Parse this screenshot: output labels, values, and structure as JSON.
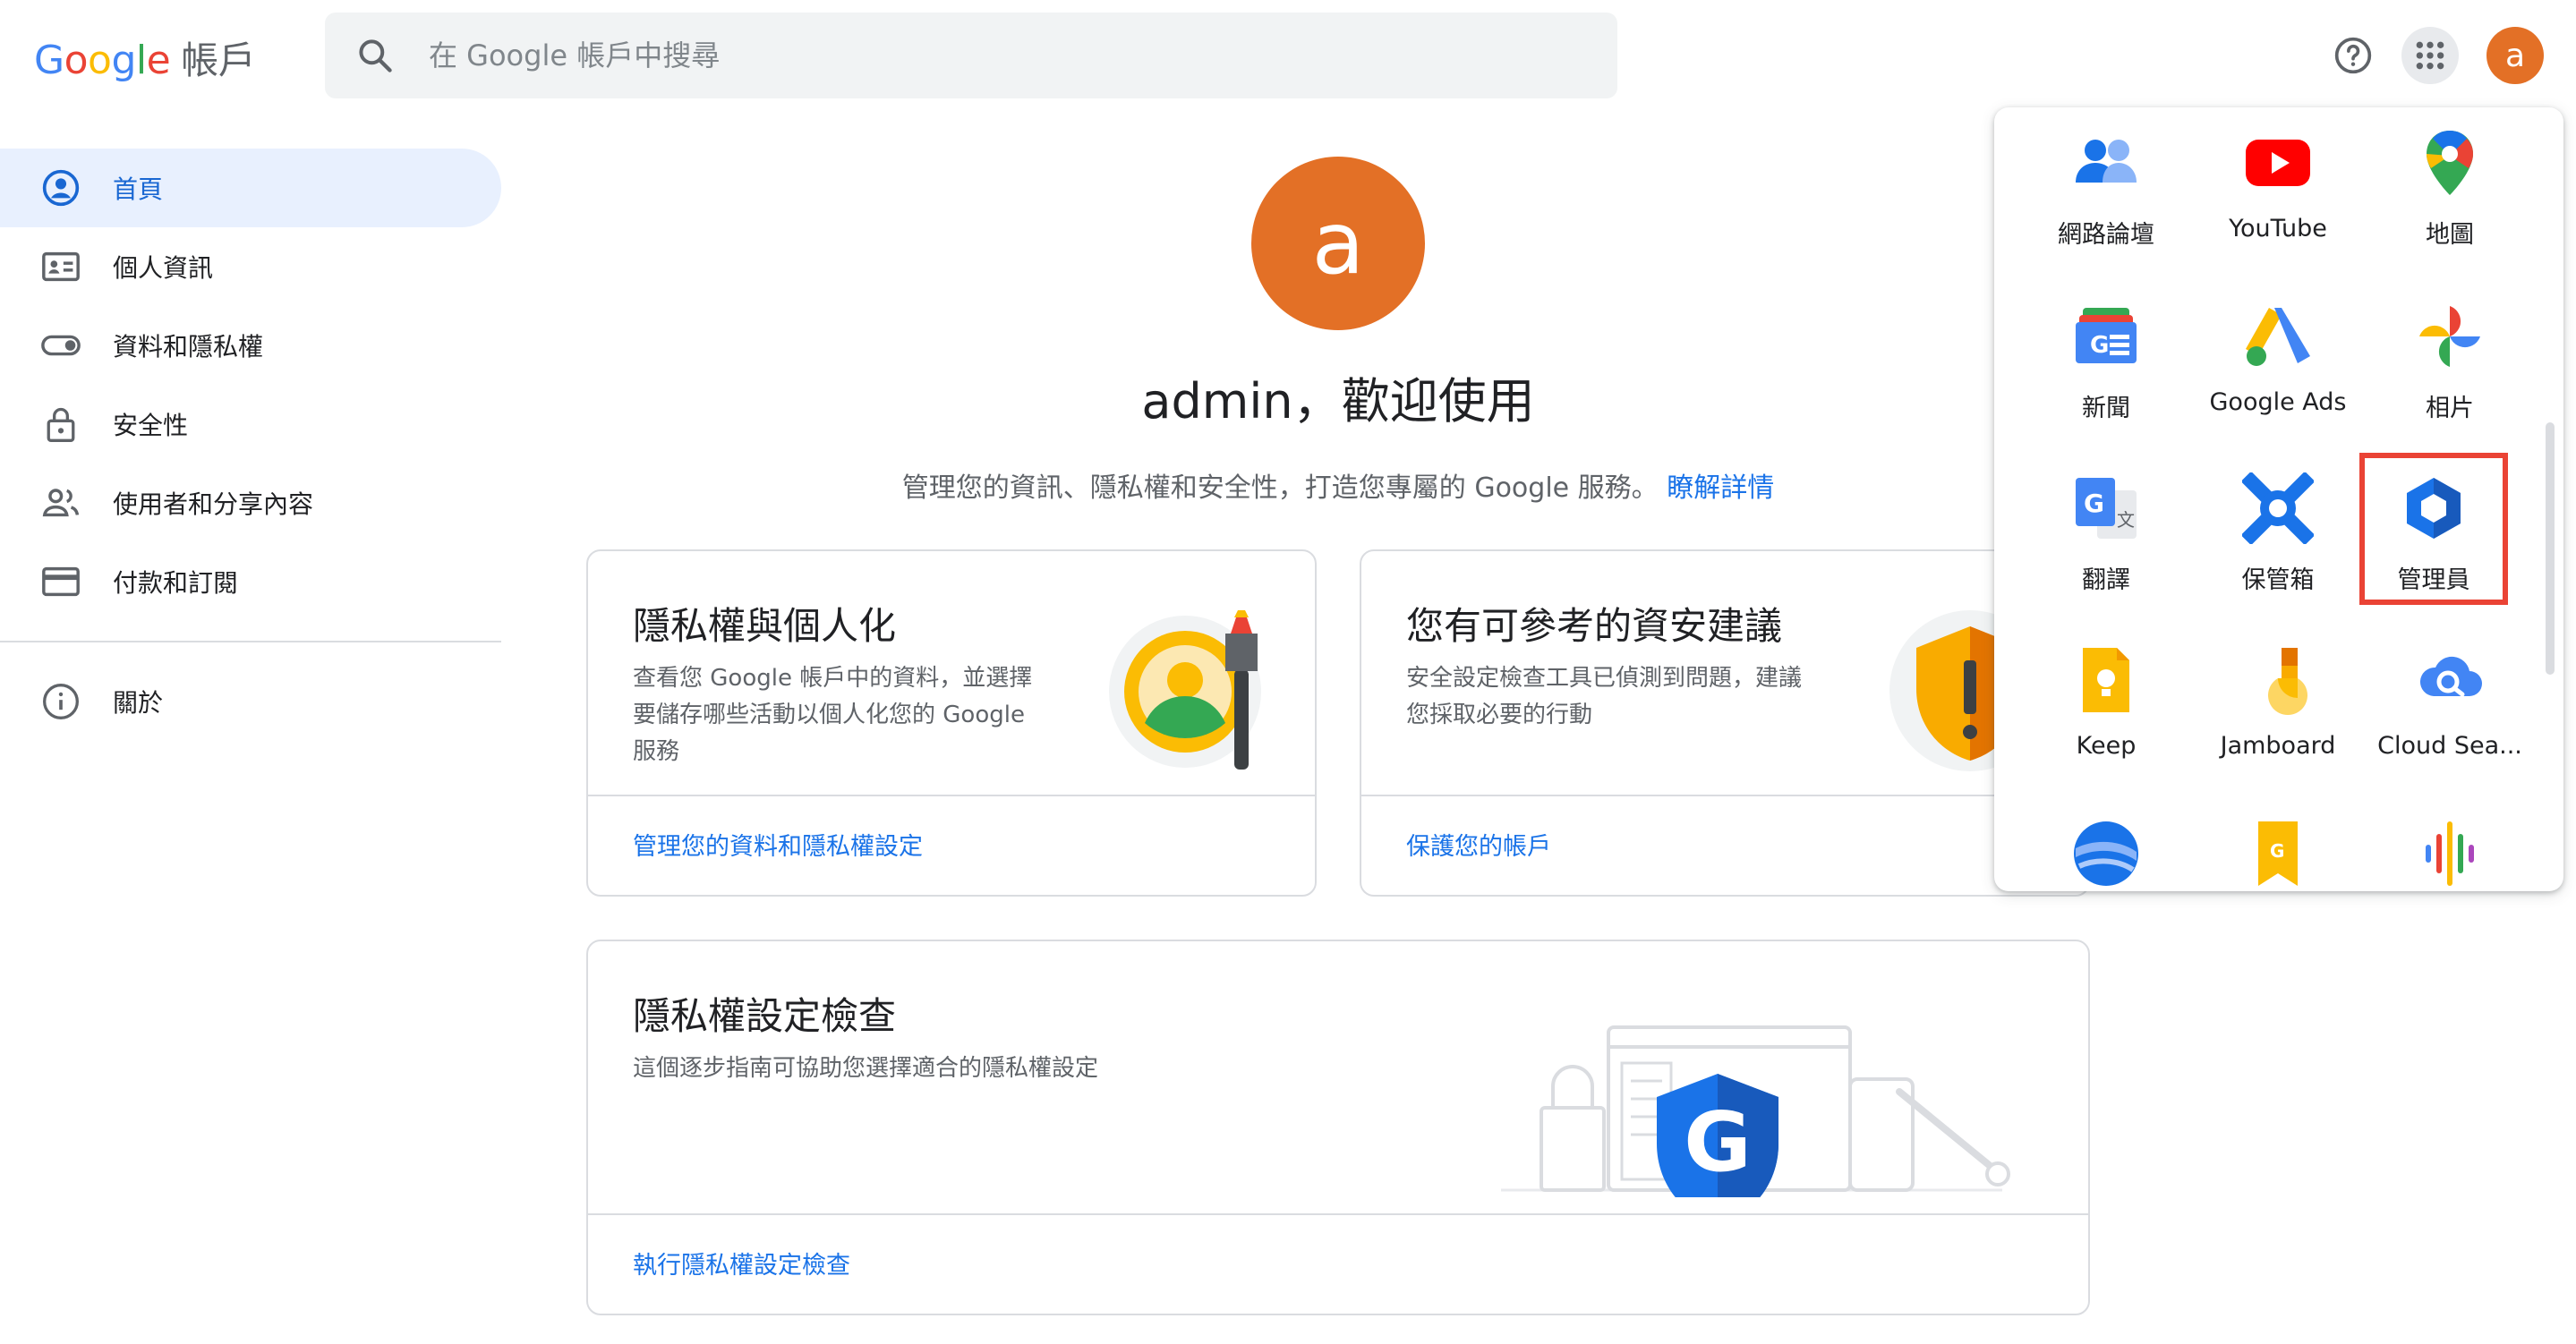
{
  "header": {
    "logo_letters": [
      "G",
      "o",
      "o",
      "g",
      "l",
      "e"
    ],
    "product_name": "帳戶",
    "search_placeholder": "在 Google 帳戶中搜尋",
    "avatar_letter": "a"
  },
  "sidebar": {
    "items": [
      {
        "label": "首頁",
        "icon": "account-circle-icon",
        "active": true
      },
      {
        "label": "個人資訊",
        "icon": "id-card-icon",
        "active": false
      },
      {
        "label": "資料和隱私權",
        "icon": "toggle-icon",
        "active": false
      },
      {
        "label": "安全性",
        "icon": "lock-icon",
        "active": false
      },
      {
        "label": "使用者和分享內容",
        "icon": "people-icon",
        "active": false
      },
      {
        "label": "付款和訂閱",
        "icon": "credit-card-icon",
        "active": false
      }
    ],
    "about_label": "關於"
  },
  "main": {
    "avatar_letter": "a",
    "welcome": "admin，歡迎使用",
    "subtitle": "管理您的資訊、隱私權和安全性，打造您專屬的 Google 服務。",
    "learn_more": "瞭解詳情",
    "cards": {
      "privacy": {
        "title": "隱私權與個人化",
        "desc_lines": [
          "查看您 Google 帳戶中的資料，並選擇",
          "要儲存哪些活動以個人化您的 Google",
          "服務"
        ],
        "link": "管理您的資料和隱私權設定"
      },
      "security": {
        "title": "您有可參考的資安建議",
        "desc_lines": [
          "安全設定檢查工具已偵測到問題，建議",
          "您採取必要的行動"
        ],
        "link": "保護您的帳戶"
      },
      "checkup": {
        "title": "隱私權設定檢查",
        "desc_lines": [
          "這個逐步指南可協助您選擇適合的隱私權設定"
        ],
        "link": "執行隱私權設定檢查"
      }
    }
  },
  "apps_panel": {
    "apps": [
      {
        "label": "網路論壇",
        "icon": "groups-icon"
      },
      {
        "label": "YouTube",
        "icon": "youtube-icon"
      },
      {
        "label": "地圖",
        "icon": "maps-icon"
      },
      {
        "label": "新聞",
        "icon": "news-icon"
      },
      {
        "label": "Google Ads",
        "icon": "ads-icon"
      },
      {
        "label": "相片",
        "icon": "photos-icon"
      },
      {
        "label": "翻譯",
        "icon": "translate-icon"
      },
      {
        "label": "保管箱",
        "icon": "vault-icon"
      },
      {
        "label": "管理員",
        "icon": "admin-icon"
      },
      {
        "label": "Keep",
        "icon": "keep-icon"
      },
      {
        "label": "Jamboard",
        "icon": "jamboard-icon"
      },
      {
        "label": "Cloud Sea...",
        "icon": "cloud-search-icon"
      },
      {
        "label": "",
        "icon": "earth-icon"
      },
      {
        "label": "",
        "icon": "arts-culture-icon"
      },
      {
        "label": "",
        "icon": "podcasts-icon"
      }
    ],
    "highlighted_app": "管理員"
  }
}
